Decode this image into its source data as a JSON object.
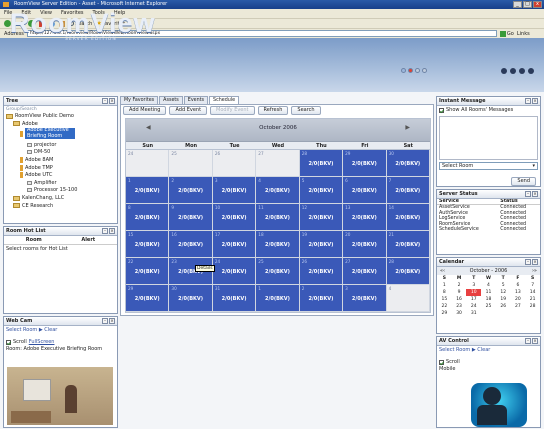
{
  "window": {
    "title": "RoomView Server Edition - Asset - Microsoft Internet Explorer",
    "buttons": [
      "_",
      "□",
      "x"
    ]
  },
  "menu": [
    "File",
    "Edit",
    "View",
    "Favorites",
    "Tools",
    "Help"
  ],
  "toolbar": {
    "back": "Back",
    "search": "Search",
    "favorites": "Favorites"
  },
  "address": {
    "label": "Address",
    "url": "http://127.0.0.1/roomview/RoomViewWeb/RoomView.aspx",
    "go": "Go",
    "links": "Links"
  },
  "banner": {
    "logo": "RoomView",
    "tagline": "SERVER EDITION"
  },
  "tree_panel": {
    "title": "Tree",
    "placeholder": "Group/Search",
    "items": [
      {
        "label": "RoomView Public Demo",
        "level": 0,
        "type": "folder"
      },
      {
        "label": "Adobe",
        "level": 1,
        "type": "folder"
      },
      {
        "label": "Adobe Executive Briefing Room",
        "level": 2,
        "type": "room",
        "selected": true
      },
      {
        "label": "projector",
        "level": 3,
        "type": "device"
      },
      {
        "label": "DM-50",
        "level": 3,
        "type": "device"
      },
      {
        "label": "Adobe 8AM",
        "level": 2,
        "type": "room"
      },
      {
        "label": "Adobe TMP",
        "level": 2,
        "type": "room"
      },
      {
        "label": "Adobe UTC",
        "level": 2,
        "type": "room"
      },
      {
        "label": "Amplifier",
        "level": 3,
        "type": "device"
      },
      {
        "label": "Processor 15-100",
        "level": 3,
        "type": "device"
      },
      {
        "label": "KalenChang, LLC",
        "level": 1,
        "type": "folder"
      },
      {
        "label": "CE Research",
        "level": 1,
        "type": "folder"
      }
    ]
  },
  "hotlist_panel": {
    "title": "Room Hot List",
    "columns": [
      "Room",
      "Alert"
    ],
    "empty_text": "Select rooms for Hot List"
  },
  "webcam_panel": {
    "title": "Web Cam",
    "links": "Select Room ▶ Clear",
    "scroll_label": "Scroll",
    "fullscreen": "FullScreen",
    "room": "Room: Adobe Executive Briefing Room"
  },
  "tabs": [
    "My Favorites",
    "Assets",
    "Events",
    "Schedule"
  ],
  "active_tab": "Schedule",
  "calendar_toolbar": {
    "add_meeting": "Add Meeting",
    "add_event": "Add Event",
    "modify_event": "Modify Event",
    "refresh": "Refresh",
    "search": "Search"
  },
  "calendar": {
    "month_label": "October 2006",
    "prev": "◀",
    "next": "▶",
    "weekdays": [
      "Sun",
      "Mon",
      "Tue",
      "Wed",
      "Thu",
      "Fri",
      "Sat"
    ],
    "cells": [
      {
        "d": "24",
        "e": "",
        "cls": "other"
      },
      {
        "d": "25",
        "e": "",
        "cls": "other"
      },
      {
        "d": "26",
        "e": "",
        "cls": "other"
      },
      {
        "d": "27",
        "e": "",
        "cls": "other"
      },
      {
        "d": "28",
        "e": "2/0(BKV)",
        "cls": "ev"
      },
      {
        "d": "29",
        "e": "2/0(BKV)",
        "cls": "ev"
      },
      {
        "d": "30",
        "e": "2/0(BKV)",
        "cls": "ev"
      },
      {
        "d": "1",
        "e": "2/0(BKV)",
        "cls": "ev"
      },
      {
        "d": "2",
        "e": "2/0(BKV)",
        "cls": "ev"
      },
      {
        "d": "3",
        "e": "2/0(BKV)",
        "cls": "ev"
      },
      {
        "d": "4",
        "e": "2/0(BKV)",
        "cls": "ev"
      },
      {
        "d": "5",
        "e": "2/0(BKV)",
        "cls": "ev"
      },
      {
        "d": "6",
        "e": "2/0(BKV)",
        "cls": "ev"
      },
      {
        "d": "7",
        "e": "2/0(BKV)",
        "cls": "ev"
      },
      {
        "d": "8",
        "e": "2/0(BKV)",
        "cls": "ev"
      },
      {
        "d": "9",
        "e": "2/0(BKV)",
        "cls": "ev"
      },
      {
        "d": "10",
        "e": "2/0(BKV)",
        "cls": "ev"
      },
      {
        "d": "11",
        "e": "2/0(BKV)",
        "cls": "ev"
      },
      {
        "d": "12",
        "e": "2/0(BKV)",
        "cls": "ev"
      },
      {
        "d": "13",
        "e": "2/0(BKV)",
        "cls": "ev"
      },
      {
        "d": "14",
        "e": "2/0(BKV)",
        "cls": "ev"
      },
      {
        "d": "15",
        "e": "2/0(BKV)",
        "cls": "ev"
      },
      {
        "d": "16",
        "e": "2/0(BKV)",
        "cls": "ev"
      },
      {
        "d": "17",
        "e": "2/0(BKV)",
        "cls": "ev"
      },
      {
        "d": "18",
        "e": "2/0(BKV)",
        "cls": "ev"
      },
      {
        "d": "19",
        "e": "2/0(BKV)",
        "cls": "ev"
      },
      {
        "d": "20",
        "e": "2/0(BKV)",
        "cls": "ev"
      },
      {
        "d": "21",
        "e": "2/0(BKV)",
        "cls": "ev"
      },
      {
        "d": "22",
        "e": "2/0(BKV)",
        "cls": "ev"
      },
      {
        "d": "23",
        "e": "2/0(BKV)",
        "cls": "ev"
      },
      {
        "d": "24",
        "e": "2/0(BKV)",
        "cls": "ev"
      },
      {
        "d": "25",
        "e": "2/0(BKV)",
        "cls": "ev"
      },
      {
        "d": "26",
        "e": "2/0(BKV)",
        "cls": "ev"
      },
      {
        "d": "27",
        "e": "2/0(BKV)",
        "cls": "ev"
      },
      {
        "d": "28",
        "e": "2/0(BKV)",
        "cls": "ev"
      },
      {
        "d": "29",
        "e": "2/0(BKV)",
        "cls": "ev"
      },
      {
        "d": "30",
        "e": "2/0(BKV)",
        "cls": "ev"
      },
      {
        "d": "31",
        "e": "2/0(BKV)",
        "cls": "ev"
      },
      {
        "d": "1",
        "e": "2/0(BKV)",
        "cls": "ev"
      },
      {
        "d": "2",
        "e": "2/0(BKV)",
        "cls": "ev"
      },
      {
        "d": "3",
        "e": "2/0(BKV)",
        "cls": "ev"
      },
      {
        "d": "4",
        "e": "",
        "cls": "other"
      }
    ],
    "tooltip": "Details"
  },
  "instant_message": {
    "title": "Instant Message",
    "show_all": "Show All Rooms' Messages",
    "select_room": "Select Room",
    "send": "Send"
  },
  "server_status": {
    "title": "Server Status",
    "columns": [
      "Service",
      "Status"
    ],
    "rows": [
      {
        "service": "AssetService",
        "status": "Connected"
      },
      {
        "service": "AuthService",
        "status": "Connected"
      },
      {
        "service": "LogService",
        "status": "Connected"
      },
      {
        "service": "RoomService",
        "status": "Connected"
      },
      {
        "service": "ScheduleService",
        "status": "Connected"
      }
    ]
  },
  "mini_calendar": {
    "title": "Calendar",
    "nav_label": "October - 2006",
    "weekdays": [
      "S",
      "M",
      "T",
      "W",
      "T",
      "F",
      "S"
    ],
    "days": [
      "",
      "",
      "",
      "",
      "",
      "",
      "",
      "1",
      "2",
      "3",
      "4",
      "5",
      "6",
      "7",
      "8",
      "9",
      "10",
      "11",
      "12",
      "13",
      "14",
      "15",
      "16",
      "17",
      "18",
      "19",
      "20",
      "21",
      "22",
      "23",
      "24",
      "25",
      "26",
      "27",
      "28",
      "29",
      "30",
      "31"
    ],
    "today": "10"
  },
  "av_control": {
    "title": "AV Control",
    "links": "Select Room ▶ Clear",
    "scroll_label": "Scroll",
    "mode": "Mobile"
  },
  "colors": {
    "event_fill": "#3a59b8",
    "banner": "#8aa6cf",
    "selection": "#316ac5"
  }
}
